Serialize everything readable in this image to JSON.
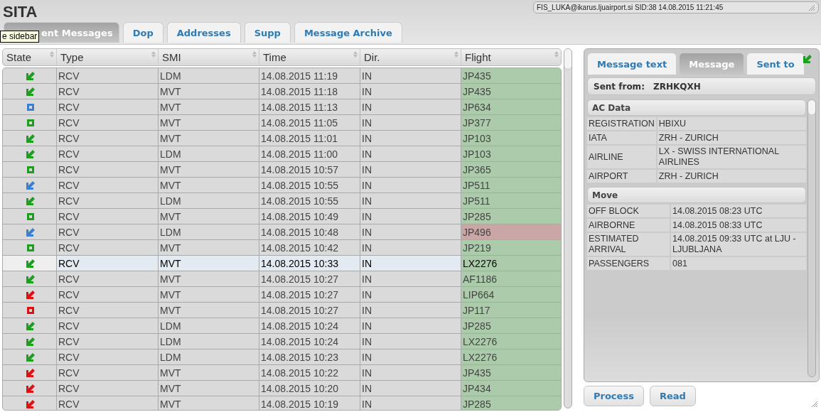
{
  "app": {
    "title": "SITA",
    "session": "FIS_LUKA@ikarus.ljuairport.si  SID:38 14.08.2015 11:21:45"
  },
  "tabs": [
    {
      "label": "ent Messages",
      "selected": true
    },
    {
      "label": "Dop",
      "selected": false
    },
    {
      "label": "Addresses",
      "selected": false
    },
    {
      "label": "Supp",
      "selected": false
    },
    {
      "label": "Message Archive",
      "selected": false
    }
  ],
  "tooltip": "e sidebar",
  "messages": {
    "columns": [
      "State",
      "Type",
      "SMI",
      "Time",
      "Dir.",
      "Flight"
    ],
    "rows": [
      {
        "state": {
          "kind": "arrow",
          "color": "#1e9e1e"
        },
        "type": "RCV",
        "smi": "LDM",
        "time": "14.08.2015 11:19",
        "dir": "IN",
        "flight": "JP435",
        "color": "#abcbab",
        "selected": false
      },
      {
        "state": {
          "kind": "arrow",
          "color": "#1e9e1e"
        },
        "type": "RCV",
        "smi": "MVT",
        "time": "14.08.2015 11:18",
        "dir": "IN",
        "flight": "JP435",
        "color": "#abcbab",
        "selected": false
      },
      {
        "state": {
          "kind": "square",
          "color": "#3d7fd0"
        },
        "type": "RCV",
        "smi": "MVT",
        "time": "14.08.2015 11:13",
        "dir": "IN",
        "flight": "JP634",
        "color": "#abcbab",
        "selected": false
      },
      {
        "state": {
          "kind": "square",
          "color": "#1e9e1e"
        },
        "type": "RCV",
        "smi": "MVT",
        "time": "14.08.2015 11:05",
        "dir": "IN",
        "flight": "JP377",
        "color": "#abcbab",
        "selected": false
      },
      {
        "state": {
          "kind": "arrow",
          "color": "#1e9e1e"
        },
        "type": "RCV",
        "smi": "MVT",
        "time": "14.08.2015 11:01",
        "dir": "IN",
        "flight": "JP103",
        "color": "#abcbab",
        "selected": false
      },
      {
        "state": {
          "kind": "arrow",
          "color": "#1e9e1e"
        },
        "type": "RCV",
        "smi": "LDM",
        "time": "14.08.2015 11:00",
        "dir": "IN",
        "flight": "JP103",
        "color": "#abcbab",
        "selected": false
      },
      {
        "state": {
          "kind": "square",
          "color": "#1e9e1e"
        },
        "type": "RCV",
        "smi": "MVT",
        "time": "14.08.2015 10:57",
        "dir": "IN",
        "flight": "JP365",
        "color": "#abcbab",
        "selected": false
      },
      {
        "state": {
          "kind": "arrow",
          "color": "#3d7fd0"
        },
        "type": "RCV",
        "smi": "MVT",
        "time": "14.08.2015 10:55",
        "dir": "IN",
        "flight": "JP511",
        "color": "#abcbab",
        "selected": false
      },
      {
        "state": {
          "kind": "arrow",
          "color": "#1e9e1e"
        },
        "type": "RCV",
        "smi": "LDM",
        "time": "14.08.2015 10:55",
        "dir": "IN",
        "flight": "JP511",
        "color": "#abcbab",
        "selected": false
      },
      {
        "state": {
          "kind": "square",
          "color": "#1e9e1e"
        },
        "type": "RCV",
        "smi": "MVT",
        "time": "14.08.2015 10:49",
        "dir": "IN",
        "flight": "JP285",
        "color": "#abcbab",
        "selected": false
      },
      {
        "state": {
          "kind": "arrow",
          "color": "#3d7fd0"
        },
        "type": "RCV",
        "smi": "LDM",
        "time": "14.08.2015 10:48",
        "dir": "IN",
        "flight": "JP496",
        "color": "#cba6a6",
        "selected": false
      },
      {
        "state": {
          "kind": "square",
          "color": "#1e9e1e"
        },
        "type": "RCV",
        "smi": "MVT",
        "time": "14.08.2015 10:42",
        "dir": "IN",
        "flight": "JP219",
        "color": "#abcbab",
        "selected": false
      },
      {
        "state": {
          "kind": "arrow",
          "color": "#1e9e1e"
        },
        "type": "RCV",
        "smi": "MVT",
        "time": "14.08.2015 10:33",
        "dir": "IN",
        "flight": "LX2276",
        "color": "#abcbab",
        "selected": true
      },
      {
        "state": {
          "kind": "arrow",
          "color": "#1e9e1e"
        },
        "type": "RCV",
        "smi": "MVT",
        "time": "14.08.2015 10:27",
        "dir": "IN",
        "flight": "AF1186",
        "color": "#abcbab",
        "selected": false
      },
      {
        "state": {
          "kind": "arrow",
          "color": "#e01010"
        },
        "type": "RCV",
        "smi": "MVT",
        "time": "14.08.2015 10:27",
        "dir": "IN",
        "flight": "LIP664",
        "color": "#abcbab",
        "selected": false
      },
      {
        "state": {
          "kind": "square",
          "color": "#e01010"
        },
        "type": "RCV",
        "smi": "MVT",
        "time": "14.08.2015 10:27",
        "dir": "IN",
        "flight": "JP117",
        "color": "#abcbab",
        "selected": false
      },
      {
        "state": {
          "kind": "arrow",
          "color": "#1e9e1e"
        },
        "type": "RCV",
        "smi": "LDM",
        "time": "14.08.2015 10:24",
        "dir": "IN",
        "flight": "JP285",
        "color": "#abcbab",
        "selected": false
      },
      {
        "state": {
          "kind": "arrow",
          "color": "#1e9e1e"
        },
        "type": "RCV",
        "smi": "LDM",
        "time": "14.08.2015 10:24",
        "dir": "IN",
        "flight": "LX2276",
        "color": "#abcbab",
        "selected": false
      },
      {
        "state": {
          "kind": "arrow",
          "color": "#1e9e1e"
        },
        "type": "RCV",
        "smi": "LDM",
        "time": "14.08.2015 10:23",
        "dir": "IN",
        "flight": "LX2276",
        "color": "#abcbab",
        "selected": false
      },
      {
        "state": {
          "kind": "arrow",
          "color": "#e01010"
        },
        "type": "RCV",
        "smi": "MVT",
        "time": "14.08.2015 10:22",
        "dir": "IN",
        "flight": "JP435",
        "color": "#abcbab",
        "selected": false
      },
      {
        "state": {
          "kind": "arrow",
          "color": "#e01010"
        },
        "type": "RCV",
        "smi": "MVT",
        "time": "14.08.2015 10:20",
        "dir": "IN",
        "flight": "JP434",
        "color": "#abcbab",
        "selected": false
      },
      {
        "state": {
          "kind": "arrow",
          "color": "#e01010"
        },
        "type": "RCV",
        "smi": "MVT",
        "time": "14.08.2015 10:19",
        "dir": "IN",
        "flight": "JP285",
        "color": "#abcbab",
        "selected": false
      }
    ]
  },
  "detail": {
    "tabs": [
      {
        "label": "Message text",
        "selected": false
      },
      {
        "label": "Message",
        "selected": true
      },
      {
        "label": "Sent to",
        "selected": false
      }
    ],
    "state": {
      "kind": "arrow",
      "color": "#1e9e1e"
    },
    "sent_from": {
      "label": "Sent from:",
      "value": "ZRHKQXH"
    },
    "sections": [
      {
        "title": "AC Data",
        "rows": [
          {
            "label": "REGISTRATION",
            "value": "HBIXU"
          },
          {
            "label": "IATA",
            "value": "ZRH - ZURICH"
          },
          {
            "label": "AIRLINE",
            "value": "LX - SWISS INTERNATIONAL AIRLINES"
          },
          {
            "label": "AIRPORT",
            "value": "ZRH - ZURICH"
          }
        ]
      },
      {
        "title": "Move",
        "rows": [
          {
            "label": "OFF BLOCK",
            "value": "14.08.2015 08:23 UTC"
          },
          {
            "label": "AIRBORNE",
            "value": "14.08.2015 08:33 UTC"
          },
          {
            "label": "ESTIMATED ARRIVAL",
            "value": "14.08.2015 09:33 UTC at LJU - LJUBLJANA"
          },
          {
            "label": "PASSENGERS",
            "value": "081"
          }
        ]
      }
    ]
  },
  "buttons": [
    "Process",
    "Read"
  ]
}
